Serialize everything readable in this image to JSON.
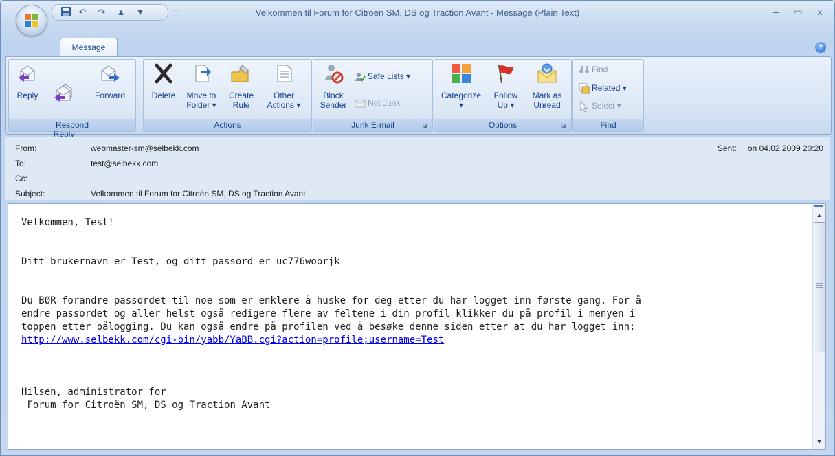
{
  "window": {
    "title": "Velkommen til Forum for Citroën SM, DS og Traction Avant - Message (Plain Text)",
    "controls": {
      "minimize": "–",
      "maximize": "▭",
      "close": "x"
    }
  },
  "quick_access": {
    "icons": [
      "save-icon",
      "undo-icon",
      "redo-icon",
      "previous-item-icon",
      "next-item-icon"
    ],
    "customize": "="
  },
  "tabs": [
    {
      "label": "Message",
      "active": true
    }
  ],
  "ribbon": {
    "groups": {
      "respond": {
        "label": "Respond",
        "reply": "Reply",
        "reply_all": "Reply\nto All",
        "forward": "Forward"
      },
      "actions": {
        "label": "Actions",
        "delete": "Delete",
        "move_to_folder": "Move to\nFolder ▾",
        "create_rule": "Create\nRule",
        "other_actions": "Other\nActions ▾"
      },
      "junk": {
        "label": "Junk E-mail",
        "block_sender": "Block\nSender",
        "safe_lists": "Safe Lists ▾",
        "not_junk": "Not Junk"
      },
      "options": {
        "label": "Options",
        "categorize": "Categorize\n▾",
        "follow_up": "Follow\nUp ▾",
        "mark_as_unread": "Mark as\nUnread"
      },
      "find": {
        "label": "Find",
        "find": "Find",
        "related": "Related ▾",
        "select": "Select ▾"
      }
    }
  },
  "header": {
    "from_label": "From:",
    "from_value": "webmaster-sm@selbekk.com",
    "to_label": "To:",
    "to_value": "test@selbekk.com",
    "cc_label": "Cc:",
    "cc_value": "",
    "subject_label": "Subject:",
    "subject_value": "Velkommen til Forum for Citroën SM, DS og Traction Avant",
    "sent_label": "Sent:",
    "sent_value": "on 04.02.2009 20:20"
  },
  "body": {
    "greeting": "Velkommen, Test!",
    "credentials": "Ditt brukernavn er Test, og ditt passord er uc776woorjk",
    "instructions": "Du BØR forandre passordet til noe som er enklere å huske for deg etter du har logget inn første gang. For å\nendre passordet og aller helst også redigere flere av feltene i din profil klikker du på profil i menyen i\ntoppen etter pålogging. Du kan også endre på profilen ved å besøke denne siden etter at du har logget inn:",
    "link": "http://www.selbekk.com/cgi-bin/yabb/YaBB.cgi?action=profile;username=Test",
    "signoff": "Hilsen, administrator for",
    "forum_name": " Forum for Citroën SM, DS og Traction Avant"
  },
  "colors": {
    "accent": "#15428b",
    "ribbon_bg": "#dae6f5",
    "link": "#0000ee"
  }
}
